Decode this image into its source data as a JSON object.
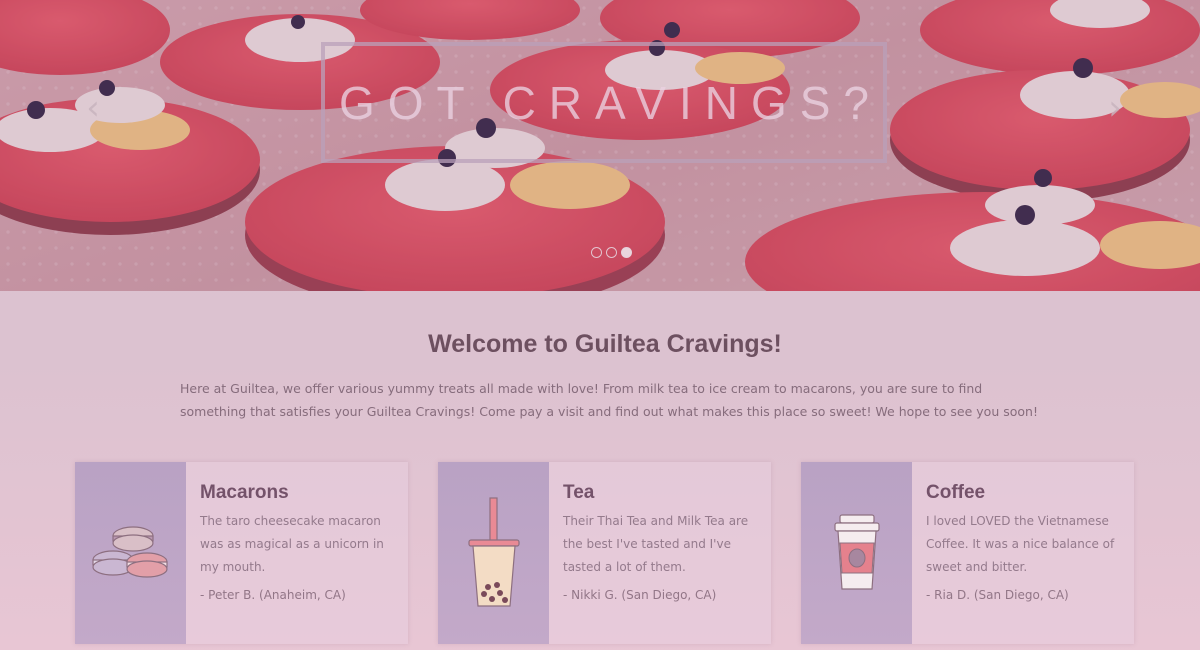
{
  "hero": {
    "headline": "GOT CRAVINGS?",
    "prev_arrow": "‹",
    "next_arrow": "›",
    "slide_count": 3,
    "active_slide": 3
  },
  "welcome": {
    "title": "Welcome to Guiltea Cravings!",
    "text": "Here at Guiltea, we offer various yummy treats all made with love! From milk tea to ice cream to macarons, you are sure to find something that satisfies your Guiltea Cravings! Come pay a visit and find out what makes this place so sweet! We hope to see you soon!"
  },
  "cards": [
    {
      "title": "Macarons",
      "quote": "The taro cheesecake macaron was as magical as a unicorn in my mouth.",
      "author": "- Peter B. (Anaheim, CA)",
      "icon": "macaron-icon"
    },
    {
      "title": "Tea",
      "quote": "Their Thai Tea and Milk Tea are the best I've tasted and I've tasted a lot of them.",
      "author": "- Nikki G. (San Diego, CA)",
      "icon": "boba-tea-icon"
    },
    {
      "title": "Coffee",
      "quote": "I loved LOVED the Vietnamese Coffee. It was a nice balance of sweet and bitter.",
      "author": "- Ria D. (San Diego, CA)",
      "icon": "coffee-cup-icon"
    }
  ],
  "colors": {
    "page_background": "#dcc2d0",
    "accent_purple": "#b9a2c4",
    "heading": "#6d5060",
    "body_text": "#866c7c"
  }
}
